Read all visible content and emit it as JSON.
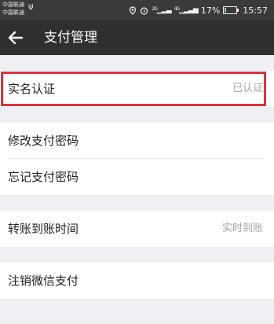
{
  "status_bar": {
    "carrier_1": "中国联通",
    "carrier_2": "中国联通",
    "network_1": "2G",
    "network_2": "4G",
    "battery": "17%",
    "battery_level": 0.17,
    "time": "15:57"
  },
  "header": {
    "title": "支付管理"
  },
  "menu": {
    "real_name": {
      "label": "实名认证",
      "value": "已认证"
    },
    "change_password": {
      "label": "修改支付密码"
    },
    "forgot_password": {
      "label": "忘记支付密码"
    },
    "transfer_time": {
      "label": "转账到账时间",
      "value": "实时到账"
    },
    "deactivate": {
      "label": "注销微信支付"
    }
  },
  "colors": {
    "highlight": "#e0303a",
    "app_bar": "#2f2f31",
    "background": "#efeff4"
  }
}
